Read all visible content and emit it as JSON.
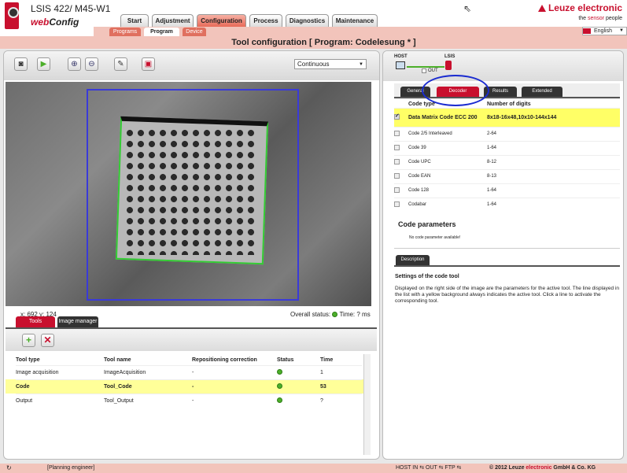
{
  "header": {
    "device_title": "LSIS 422/ M45-W1",
    "app_name_prefix": "web",
    "app_name_suffix": "Config",
    "brand": "Leuze electronic",
    "tagline_prefix": "the ",
    "tagline_accent": "sensor",
    "tagline_suffix": " people",
    "language": "English",
    "main_tabs": [
      "Start",
      "Adjustment",
      "Configuration",
      "Process",
      "Diagnostics",
      "Maintenance"
    ],
    "active_main_tab": "Configuration",
    "sub_tabs": [
      "Programs",
      "Program",
      "Device"
    ],
    "active_sub_tab": "Program"
  },
  "page_title": "Tool configuration   [ Program: Codelesung * ]",
  "left": {
    "mode_select": "Continuous",
    "coord_readout": "x: 692 y: 124",
    "overall_status_label": "Overall status:",
    "time_label": "Time: ? ms",
    "bottom_tabs": [
      "Tools",
      "Image manager"
    ],
    "active_bottom_tab": "Tools",
    "tools_table": {
      "headers": [
        "Tool type",
        "Tool name",
        "Repositioning correction",
        "Status",
        "Time"
      ],
      "rows": [
        {
          "type": "Image acquisition",
          "name": "ImageAcquisition",
          "repos": "-",
          "time": "1"
        },
        {
          "type": "Code",
          "name": "Tool_Code",
          "repos": "-",
          "time": "53"
        },
        {
          "type": "Output",
          "name": "Tool_Output",
          "repos": "-",
          "time": "?"
        }
      ],
      "selected_row": 1
    }
  },
  "right": {
    "host_label": "HOST",
    "lsis_label": "LSIS",
    "out_label": "OUT",
    "tabs": [
      "General",
      "Decoder",
      "Results",
      "Extended"
    ],
    "active_tab": "Decoder",
    "decoder_table": {
      "headers": [
        "Code type",
        "Number of digits"
      ],
      "rows": [
        {
          "type": "Data Matrix Code ECC 200",
          "digits": "8x18-16x48,10x10-144x144",
          "checked": true
        },
        {
          "type": "Code 2/5 Interleaved",
          "digits": "2-64",
          "checked": false
        },
        {
          "type": "Code 39",
          "digits": "1-64",
          "checked": false
        },
        {
          "type": "Code UPC",
          "digits": "8-12",
          "checked": false
        },
        {
          "type": "Code EAN",
          "digits": "8-13",
          "checked": false
        },
        {
          "type": "Code 128",
          "digits": "1-64",
          "checked": false
        },
        {
          "type": "Codabar",
          "digits": "1-64",
          "checked": false
        }
      ]
    },
    "code_params_title": "Code parameters",
    "code_params_note": "No code parameter available!",
    "desc_tab": "Description",
    "desc_title": "Settings of the code tool",
    "desc_text": "Displayed on the right side of the image are the parameters for the active tool. The line displayed in the list with a yellow background always indicates the active tool. Click a line to activate the corresponding tool."
  },
  "statusbar": {
    "role": "[Planning engineer]",
    "connections": "HOST IN ⇆ OUT ⇆ FTP ⇆",
    "copyright_prefix": "© 2012 Leuze ",
    "copyright_accent": "electronic",
    "copyright_suffix": " GmbH & Co. KG"
  },
  "colors": {
    "accent": "#c8102e",
    "highlight": "#ffff99",
    "status_ok": "#4caf2a",
    "roi": "#3a3ad8"
  }
}
